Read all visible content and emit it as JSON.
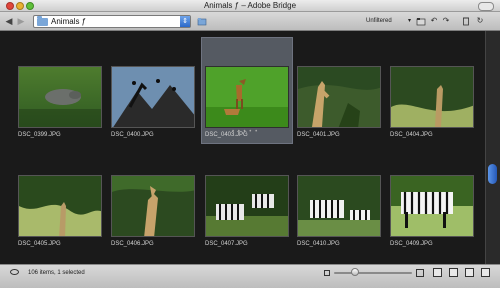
{
  "window": {
    "title": "Animals ƒ – Adobe Bridge"
  },
  "toolbar": {
    "path_label": "Animals ƒ",
    "filter_label": "Unfiltered",
    "filter_caret": "▾"
  },
  "thumbnails": [
    {
      "name": "DSC_0399.JPG",
      "scene": "hippo",
      "colors": [
        "#3d6b2a",
        "#78a548"
      ]
    },
    {
      "name": "DSC_0400.JPG",
      "scene": "birds",
      "colors": [
        "#2b4a64",
        "#8aa9c4"
      ]
    },
    {
      "name": "DSC_0403.JPG",
      "scene": "gazelles",
      "colors": [
        "#3f8d1c",
        "#7cc83a"
      ]
    },
    {
      "name": "DSC_0401.JPG",
      "scene": "giraffe",
      "colors": [
        "#2d4a22",
        "#5f7f42"
      ]
    },
    {
      "name": "DSC_0404.JPG",
      "scene": "giraffe",
      "colors": [
        "#2f4a1e",
        "#6b8a45"
      ]
    },
    {
      "name": "DSC_0405.JPG",
      "scene": "foliage",
      "colors": [
        "#2a4a1c",
        "#9fae5a"
      ]
    },
    {
      "name": "DSC_0406.JPG",
      "scene": "giraffe",
      "colors": [
        "#2b4820",
        "#6a8b44"
      ]
    },
    {
      "name": "DSC_0407.JPG",
      "scene": "zebras",
      "colors": [
        "#223d18",
        "#5d7b37"
      ]
    },
    {
      "name": "DSC_0410.JPG",
      "scene": "zebras",
      "colors": [
        "#2e4d22",
        "#6d8d45"
      ]
    },
    {
      "name": "DSC_0409.JPG",
      "scene": "zebra",
      "colors": [
        "#3f6a25",
        "#a0be6a"
      ]
    }
  ],
  "status": {
    "text": "106 items, 1 selected"
  }
}
